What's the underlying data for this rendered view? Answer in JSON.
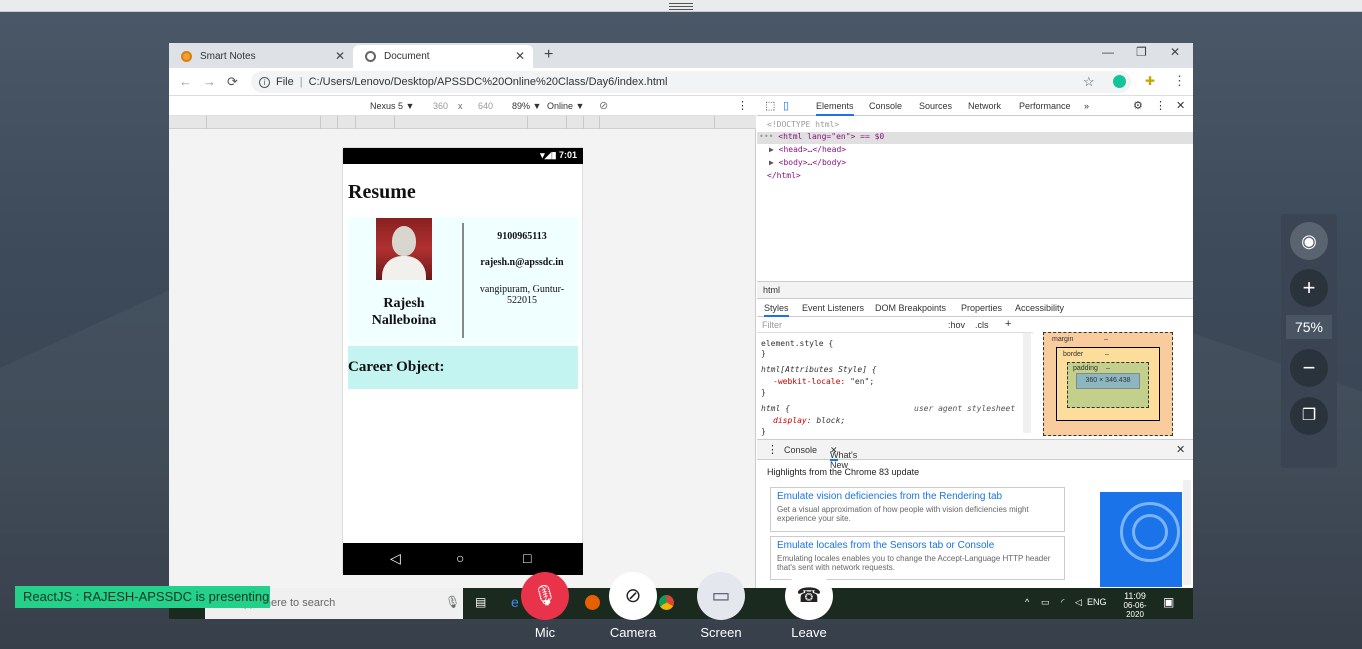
{
  "chrome": {
    "tabs": [
      {
        "label": "Smart Notes"
      },
      {
        "label": "Document"
      }
    ],
    "address": {
      "scheme": "File",
      "url": "C:/Users/Lenovo/Desktop/APSSDC%20Online%20Class/Day6/index.html"
    }
  },
  "device_toolbar": {
    "device": "Nexus 5 ▼",
    "width": "360",
    "times": "x",
    "height": "640",
    "zoom": "89% ▼",
    "network": "Online ▼"
  },
  "phone": {
    "time": "7:01",
    "resume_title": "Resume",
    "name_line1": "Rajesh",
    "name_line2": "Nalleboina",
    "phone": "9100965113",
    "email": "rajesh.n@apssdc.in",
    "address": "vangipuram, Guntur-522015",
    "career_label": "Career Object:"
  },
  "devtools": {
    "tabs": [
      "Elements",
      "Console",
      "Sources",
      "Network",
      "Performance",
      "»"
    ],
    "dom": {
      "doctype": "<!DOCTYPE html>",
      "html_open": "<html lang=\"en\"> == $0",
      "head": "<head>…</head>",
      "body": "<body>…</body>",
      "html_close": "</html>"
    },
    "breadcrumb": "html",
    "subtabs": [
      "Styles",
      "Event Listeners",
      "DOM Breakpoints",
      "Properties",
      "Accessibility"
    ],
    "filter_placeholder": "Filter",
    "hov": ":hov",
    "cls": ".cls",
    "styles": {
      "rule1": "element.style {",
      "rule1_close": "}",
      "rule2": "html[Attributes Style] {",
      "rule2_prop": "-webkit-locale:",
      "rule2_val": "\"en\";",
      "rule2_close": "}",
      "rule3": "html {",
      "rule3_src": "user agent stylesheet",
      "rule3_prop": "display:",
      "rule3_val": "block;",
      "rule3_close": "}"
    },
    "box_model": {
      "margin": "margin",
      "margin_val": "–",
      "border": "border",
      "border_val": "–",
      "padding": "padding",
      "padding_val": "–",
      "content": "360 × 346.438"
    },
    "drawer": {
      "tabs": [
        "Console",
        "What's New"
      ],
      "highlights": "Highlights from the Chrome 83 update",
      "cards": [
        {
          "title": "Emulate vision deficiencies from the Rendering tab",
          "desc": "Get a visual approximation of how people with vision deficiencies might experience your site."
        },
        {
          "title": "Emulate locales from the Sensors tab or Console",
          "desc": "Emulating locales enables you to change the Accept-Language HTTP header that's sent with network requests."
        }
      ]
    }
  },
  "taskbar": {
    "search": "Type here to search",
    "lang": "ENG",
    "time": "11:09",
    "date": "06-06-2020"
  },
  "zoom": {
    "level": "75%"
  },
  "banner": {
    "text": "ReactJS : RAJESH-APSSDC is presenting"
  },
  "meeting_controls": [
    {
      "label": "Mic",
      "color": "#e8334a"
    },
    {
      "label": "Camera",
      "color": "#ffffff"
    },
    {
      "label": "Screen",
      "color": "#e4e8ee"
    },
    {
      "label": "Leave",
      "color": "#ffffff"
    }
  ]
}
